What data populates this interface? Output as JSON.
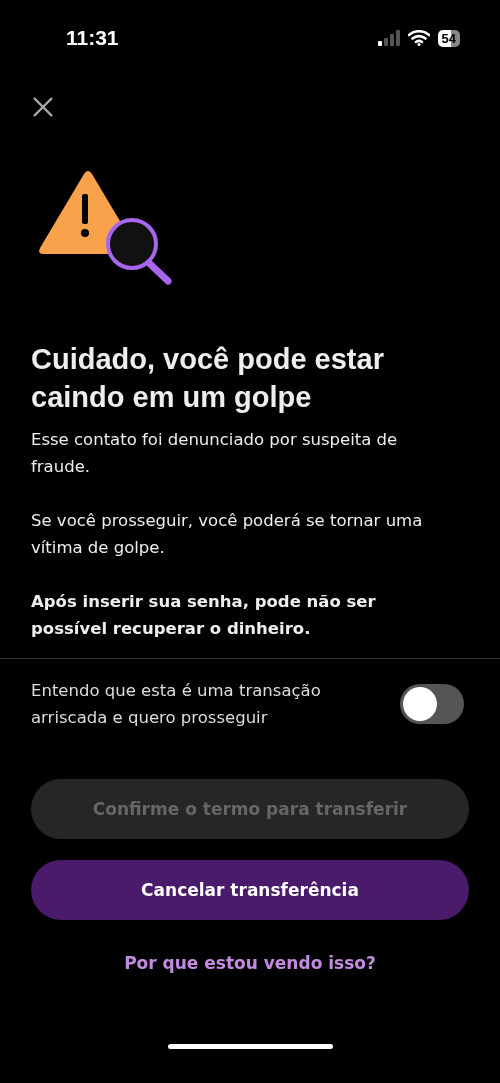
{
  "status_bar": {
    "time": "11:31",
    "battery": "54"
  },
  "title": "Cuidado, você pode estar caindo em um golpe",
  "paragraphs": [
    {
      "text": "Esse contato foi denunciado por suspeita de fraude.",
      "bold": false
    },
    {
      "text": "Se você prosseguir, você poderá se tornar uma vítima de golpe.",
      "bold": false
    },
    {
      "text": "Após inserir sua senha, pode não ser possível recuperar o dinheiro.",
      "bold": true
    }
  ],
  "consent": {
    "label": "Entendo que esta é uma transação arriscada e quero prosseguir",
    "on": false
  },
  "buttons": [
    {
      "label": "Confirme o termo para transferir",
      "kind": "confirm",
      "disabled": true
    },
    {
      "label": "Cancelar transferência",
      "kind": "cancel",
      "disabled": false
    }
  ],
  "link": "Por que estou vendo isso?"
}
